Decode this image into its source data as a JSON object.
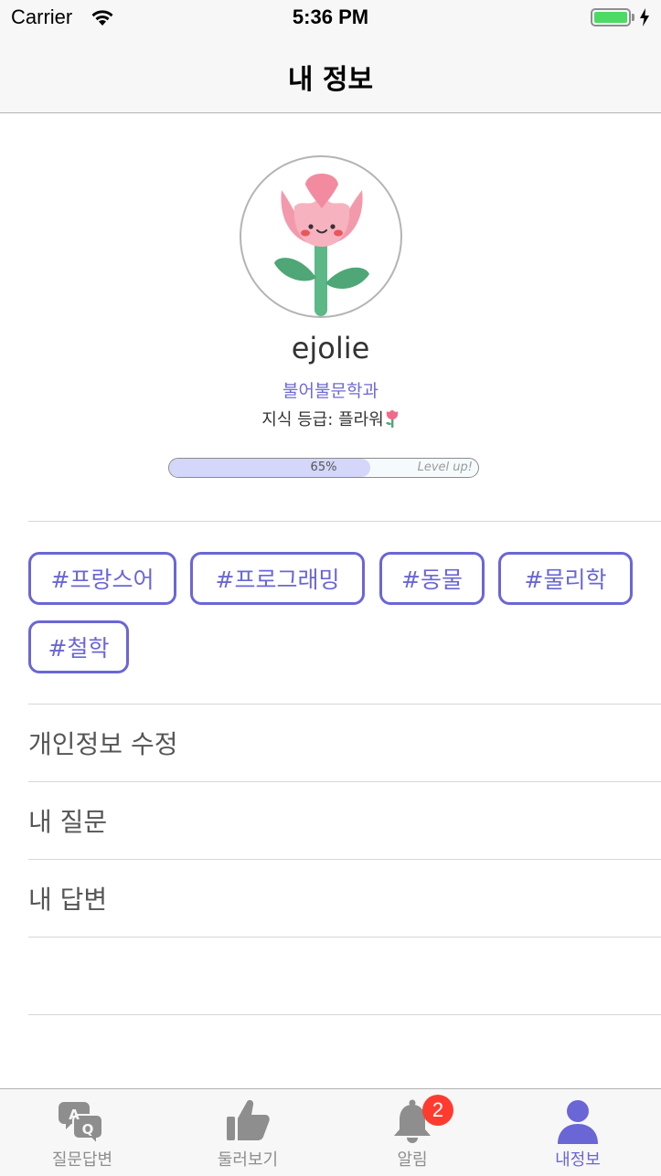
{
  "status_bar": {
    "carrier": "Carrier",
    "time": "5:36 PM"
  },
  "nav": {
    "title": "내 정보"
  },
  "profile": {
    "username": "ejolie",
    "department": "불어불문학과",
    "grade_text": "지식 등급: 플라워",
    "progress": {
      "percent": 65,
      "label": "65%",
      "level_text": "Level up!"
    }
  },
  "tags": [
    "#프랑스어",
    "#프로그래밍",
    "#동물",
    "#물리학",
    "#철학"
  ],
  "menu": [
    "개인정보 수정",
    "내 질문",
    "내 답변"
  ],
  "tab_bar": {
    "tabs": [
      {
        "label": "질문답변",
        "icon": "qa-bubble-icon",
        "active": false
      },
      {
        "label": "둘러보기",
        "icon": "thumbs-up-icon",
        "active": false
      },
      {
        "label": "알림",
        "icon": "bell-icon",
        "active": false
      },
      {
        "label": "내정보",
        "icon": "person-icon",
        "active": true
      }
    ],
    "notification_badge": "2"
  },
  "colors": {
    "accent": "#6a66d6",
    "badge": "#ff3b30",
    "battery": "#4cd964",
    "progress_fill": "#d4d6fa"
  }
}
